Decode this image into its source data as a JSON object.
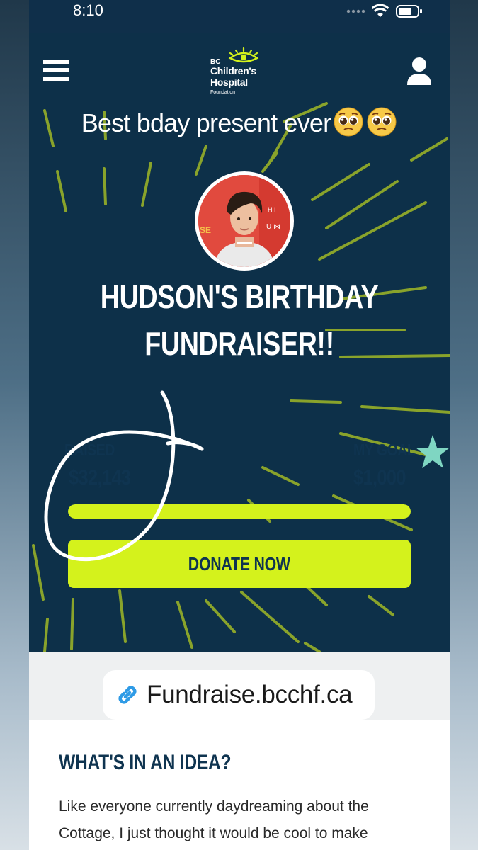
{
  "status_bar": {
    "time": "8:10"
  },
  "header": {
    "logo": {
      "line_bc": "BC",
      "line1": "Children's",
      "line2": "Hospital",
      "line3": "Foundation"
    },
    "menu_icon": "hamburger-menu-icon",
    "account_icon": "user-icon"
  },
  "story": {
    "caption": "Best bday present ever",
    "emoji": [
      "pleading-face-emoji",
      "pleading-face-emoji"
    ]
  },
  "fundraiser": {
    "title_line1": "HUDSON'S BIRTHDAY",
    "title_line2": "FUNDRAISER!!",
    "raised_label": "RAISED",
    "raised_amount": "$32,143",
    "goal_label": "MY GOAL",
    "goal_amount": "$1,000",
    "progress_fraction": 1.0,
    "donate_label": "DONATE NOW"
  },
  "link_sticker": {
    "text": "Fundraise.bcchf.ca",
    "icon": "link-icon"
  },
  "about": {
    "heading": "WHAT'S IN AN IDEA?",
    "body": "Like everyone currently daydreaming about the Cottage, I just thought it would be cool to make"
  },
  "colors": {
    "navy": "#0d3049",
    "lime": "#d4f21c",
    "teal_star": "#7fd6c2"
  }
}
